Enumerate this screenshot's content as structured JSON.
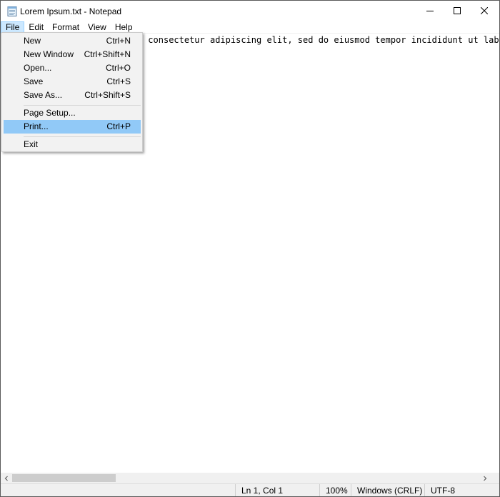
{
  "window": {
    "title": "Lorem Ipsum.txt - Notepad"
  },
  "menubar": {
    "items": [
      {
        "label": "File",
        "active": true
      },
      {
        "label": "Edit"
      },
      {
        "label": "Format"
      },
      {
        "label": "View"
      },
      {
        "label": "Help"
      }
    ]
  },
  "editor": {
    "text": "Lorem ipsum dolor sit amet, consectetur adipiscing elit, sed do eiusmod tempor incididunt ut labore et dolore magna aliqua."
  },
  "file_menu": {
    "items": [
      {
        "label": "New",
        "shortcut": "Ctrl+N"
      },
      {
        "label": "New Window",
        "shortcut": "Ctrl+Shift+N"
      },
      {
        "label": "Open...",
        "shortcut": "Ctrl+O"
      },
      {
        "label": "Save",
        "shortcut": "Ctrl+S"
      },
      {
        "label": "Save As...",
        "shortcut": "Ctrl+Shift+S"
      },
      {
        "label": "Page Setup...",
        "shortcut": ""
      },
      {
        "label": "Print...",
        "shortcut": "Ctrl+P",
        "highlighted": true
      },
      {
        "label": "Exit",
        "shortcut": ""
      }
    ]
  },
  "statusbar": {
    "position": "Ln 1, Col 1",
    "zoom": "100%",
    "line_ending": "Windows (CRLF)",
    "encoding": "UTF-8"
  },
  "icons": {
    "app": "notepad-icon",
    "minimize": "minimize-icon",
    "maximize": "maximize-icon",
    "close": "close-icon",
    "scroll_left": "chevron-left-icon",
    "scroll_right": "chevron-right-icon"
  },
  "colors": {
    "menu_active_bg": "#cce8ff",
    "menu_highlight_bg": "#91c9f7",
    "dropdown_bg": "#f2f2f2",
    "statusbar_bg": "#f0f0f0"
  }
}
